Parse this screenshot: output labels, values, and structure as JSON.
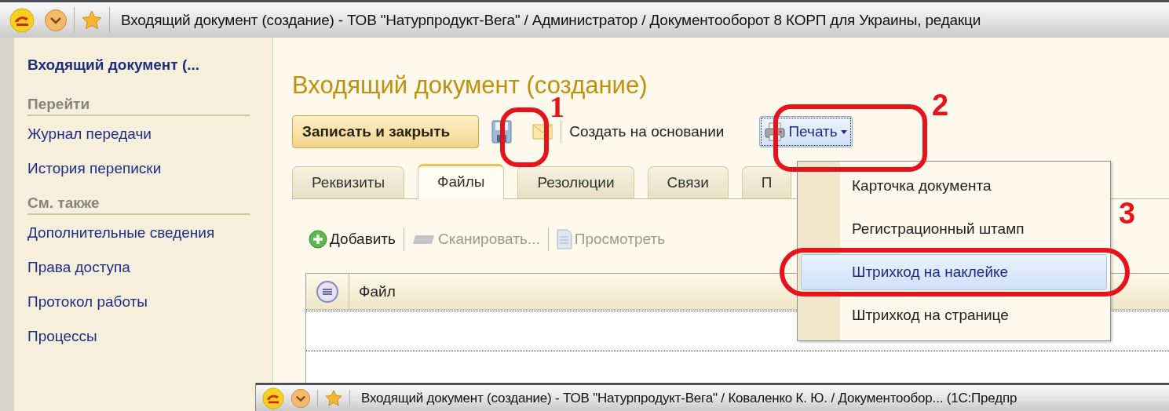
{
  "window": {
    "title": "Входящий документ (создание) - ТОВ \"Натурпродукт-Вега\" / Администратор / Документооборот 8 КОРП для Украины, редакци"
  },
  "sidebar": {
    "header": "Входящий документ (...",
    "sections": [
      {
        "title": "Перейти",
        "items": [
          "Журнал передачи",
          "История переписки"
        ]
      },
      {
        "title": "См. также",
        "items": [
          "Дополнительные сведения",
          "Права доступа",
          "Протокол работы",
          "Процессы"
        ]
      }
    ]
  },
  "form": {
    "title": "Входящий документ (создание)",
    "toolbar": {
      "primary_button": "Записать и закрыть",
      "create_based_on": "Создать на основании",
      "print_button": "Печать"
    },
    "tabs": [
      {
        "label": "Реквизиты",
        "selected": false
      },
      {
        "label": "Файлы",
        "selected": true
      },
      {
        "label": "Резолюции",
        "selected": false
      },
      {
        "label": "Связи",
        "selected": false
      },
      {
        "label": "П",
        "selected": false
      }
    ],
    "files_toolbar": [
      {
        "kind": "add",
        "label": "Добавить",
        "disabled": false
      },
      {
        "kind": "scan",
        "label": "Сканировать...",
        "disabled": true
      },
      {
        "kind": "view",
        "label": "Просмотреть",
        "disabled": true
      }
    ],
    "table": {
      "columns": [
        "Файл"
      ]
    }
  },
  "print_menu": {
    "items": [
      {
        "label": "Карточка документа",
        "selected": false
      },
      {
        "label": "Регистрационный штамп",
        "selected": false
      },
      {
        "label": "Штрихкод на наклейке",
        "selected": true
      },
      {
        "label": "Штрихкод на странице",
        "selected": false
      }
    ]
  },
  "annotations": [
    {
      "label": "1"
    },
    {
      "label": "2"
    },
    {
      "label": "3"
    }
  ],
  "second_window": {
    "title": "Входящий документ (создание) - ТОВ \"Натурпродукт-Вега\" / Коваленко К. Ю. / Документообор...  (1С:Предпр"
  }
}
